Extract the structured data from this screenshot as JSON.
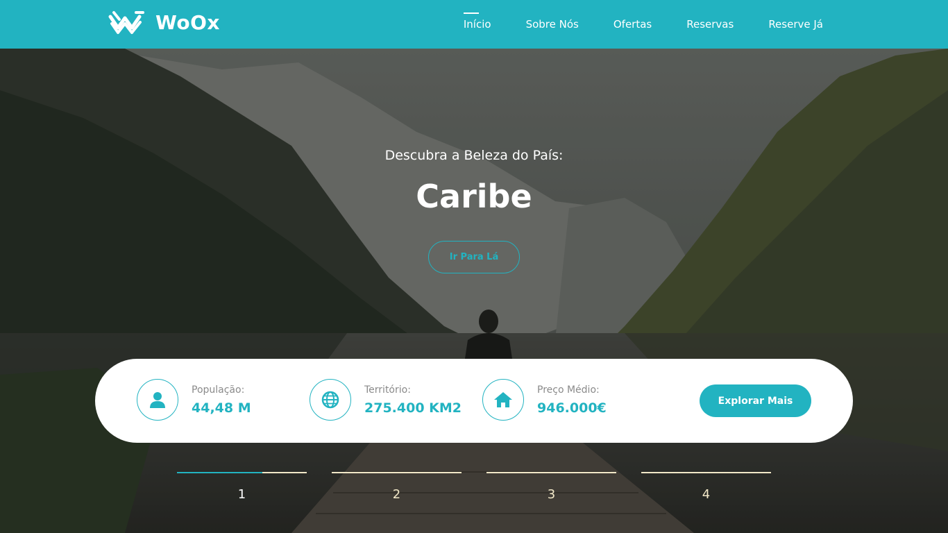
{
  "brand": {
    "name": "WoOx",
    "accent_color": "#22b3c1"
  },
  "nav": {
    "items": [
      {
        "label": "Início",
        "active": true
      },
      {
        "label": "Sobre Nós",
        "active": false
      },
      {
        "label": "Ofertas",
        "active": false
      },
      {
        "label": "Reservas",
        "active": false
      },
      {
        "label": "Reserve Já",
        "active": false
      }
    ]
  },
  "hero": {
    "subtitle": "Descubra a Beleza do País:",
    "title": "Caribe",
    "button_label": "Ir Para Lá"
  },
  "stats": [
    {
      "icon": "user-icon",
      "label": "População:",
      "value": "44,48 M"
    },
    {
      "icon": "globe-icon",
      "label": "Território:",
      "value": "275.400 KM2"
    },
    {
      "icon": "home-icon",
      "label": "Preço Médio:",
      "value": "946.000€"
    }
  ],
  "explore_button_label": "Explorar Mais",
  "slider": {
    "items": [
      {
        "label": "1",
        "active": true,
        "progress": 0.66
      },
      {
        "label": "2",
        "active": false,
        "progress": 0
      },
      {
        "label": "3",
        "active": false,
        "progress": 0
      },
      {
        "label": "4",
        "active": false,
        "progress": 0
      }
    ]
  }
}
